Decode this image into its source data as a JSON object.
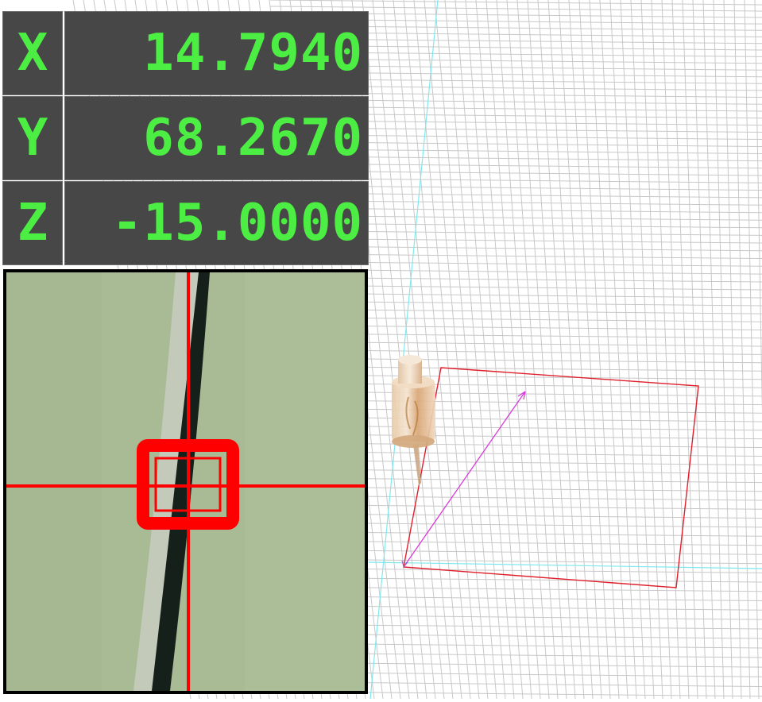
{
  "readout": {
    "x": {
      "axis": "X",
      "value": "14.7940"
    },
    "y": {
      "axis": "Y",
      "value": "68.2670"
    },
    "z": {
      "axis": "Z",
      "value": "-15.0000"
    }
  },
  "colors": {
    "readout_text": "#4dee43",
    "readout_bg": "#474747",
    "grid": "#c8c8c8",
    "axis_line": "#7fe8ee",
    "work_area": "#e0202c",
    "toolpath": "#d93ad9",
    "crosshair": "#ff0000",
    "camera_bg": "#a8bb95"
  },
  "icons": {
    "tool": "spindle-tool-icon",
    "crosshair": "crosshair-reticle-icon"
  }
}
